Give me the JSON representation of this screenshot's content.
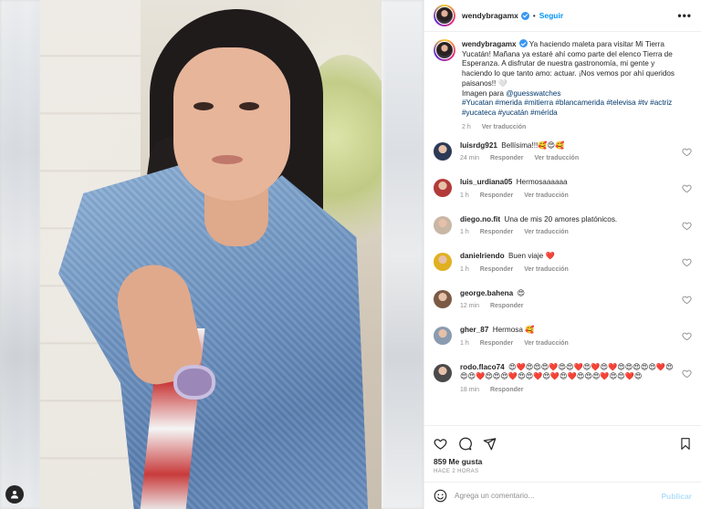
{
  "post": {
    "username": "wendybragamx",
    "follow_label": "Seguir",
    "dot": "•",
    "more_label": "•••",
    "caption_text": " Ya haciendo maleta para visitar Mi Tierra Yucatán! Mañana ya estaré ahí como parte del elenco Tierra de Esperanza. A disfrutar de nuestra gastronomía, mi gente y haciendo lo que tanto amo: actuar. ¡Nos vemos por ahí queridos paisanos!! 🤍",
    "caption_credit_prefix": "Imagen para ",
    "caption_mention": "@guesswatches",
    "caption_hashtags": "#Yucatan #merida #mitierra #blancamerida #televisa #tv #actriz #yucateca #yucatán #mérida",
    "caption_time": "2 h",
    "caption_translate": "Ver traducción"
  },
  "comments": [
    {
      "user": "luisrdg921",
      "text": "Bellísima!!!🥰😍🥰",
      "time": "24 min",
      "reply": "Responder",
      "translate": "Ver traducción",
      "avatar_color": "#2d3a55"
    },
    {
      "user": "luis_urdiana05",
      "text": "Hermosaaaaaa",
      "time": "1 h",
      "reply": "Responder",
      "translate": "Ver traducción",
      "avatar_color": "#b23a3a"
    },
    {
      "user": "diego.no.fit",
      "text": "Una de mis 20 amores platónicos.",
      "time": "1 h",
      "reply": "Responder",
      "translate": "Ver traducción",
      "avatar_color": "#c9b7a6"
    },
    {
      "user": "danielriendo",
      "text": "Buen viaje ❤️",
      "time": "1 h",
      "reply": "Responder",
      "translate": "Ver traducción",
      "avatar_color": "#e0b020"
    },
    {
      "user": "george.bahena",
      "text": "😍",
      "time": "12 min",
      "reply": "Responder",
      "translate": "",
      "avatar_color": "#7b5a45"
    },
    {
      "user": "gher_87",
      "text": "Hermosa 🥰",
      "time": "1 h",
      "reply": "Responder",
      "translate": "Ver traducción",
      "avatar_color": "#8a9bb0"
    },
    {
      "user": "rodo.flaco74",
      "text": "😍❤️😍😍😍❤️😍😍❤️😍❤️😍❤️😍😍😍😍😍❤️😍😍😍❤️😍😍😍❤️😍😍❤️😍❤️😍❤️😍😍😍❤️😍😍❤️😍",
      "time": "18 min",
      "reply": "Responder",
      "translate": "",
      "avatar_color": "#4a4a4a"
    }
  ],
  "footer": {
    "likes": "859 Me gusta",
    "time": "HACE 2 HORAS",
    "comment_placeholder": "Agrega un comentario...",
    "post_label": "Publicar"
  },
  "colors": {
    "accent": "#0095f6",
    "verified": "#3897f0",
    "muted": "#8e8e8e",
    "heart": "#ed4956"
  }
}
